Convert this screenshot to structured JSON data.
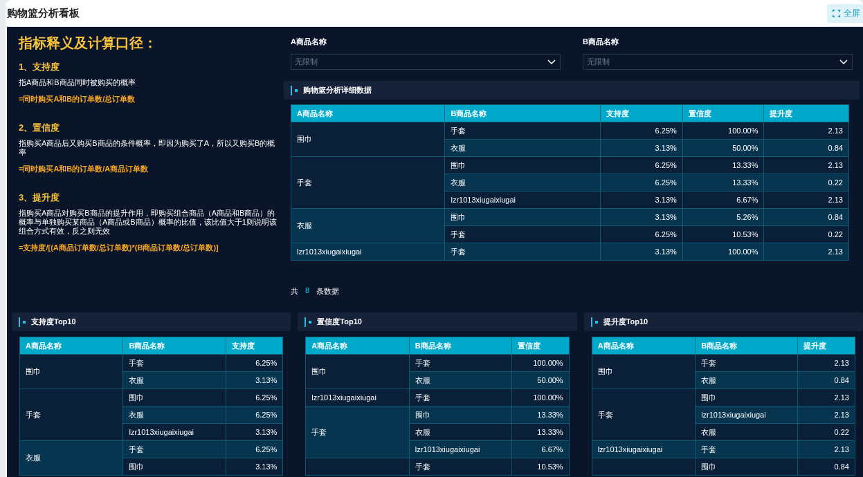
{
  "page": {
    "title": "购物篮分析看板",
    "fullscreen_button": {
      "label": "全屏"
    }
  },
  "definitions": {
    "heading": "指标释义及计算口径：",
    "items": [
      {
        "title": "1、支持度",
        "description": "指A商品和B商品同时被购买的概率",
        "formula": "=同时购买A和B的订单数/总订单数"
      },
      {
        "title": "2、置信度",
        "description": "指购买A商品后又购买B商品的条件概率，即因为购买了A，所以又购买B的概率",
        "formula": "=同时购买A和B的订单数/A商品订单数"
      },
      {
        "title": "3、提升度",
        "description": "指购买A商品对购买B商品的提升作用，即购买组合商品（A商品和B商品）的概率与单独购买某商品（A商品或B商品）概率的比值，该比值大于1则说明该组合方式有效，反之则无效",
        "formula": "=支持度/[(A商品订单数/总订单数)*(B商品订单数/总订单数)]"
      }
    ]
  },
  "filters": [
    {
      "label": "A商品名称",
      "placeholder": "无限制"
    },
    {
      "label": "B商品名称",
      "placeholder": "无限制"
    }
  ],
  "detail": {
    "title": "购物篮分析详细数据",
    "columns": [
      "A商品名称",
      "B商品名称",
      "支持度",
      "置信度",
      "提升度"
    ],
    "groups": [
      {
        "a": "围巾",
        "rows": [
          [
            "手套",
            "6.25%",
            "100.00%",
            "2.13"
          ],
          [
            "衣服",
            "3.13%",
            "50.00%",
            "0.84"
          ]
        ]
      },
      {
        "a": "手套",
        "rows": [
          [
            "围巾",
            "6.25%",
            "13.33%",
            "2.13"
          ],
          [
            "衣服",
            "6.25%",
            "13.33%",
            "0.22"
          ],
          [
            "lzr1013xiugaixiugai",
            "3.13%",
            "6.67%",
            "2.13"
          ]
        ]
      },
      {
        "a": "衣服",
        "rows": [
          [
            "围巾",
            "3.13%",
            "5.26%",
            "0.84"
          ],
          [
            "手套",
            "6.25%",
            "10.53%",
            "0.22"
          ]
        ]
      },
      {
        "a": "lzr1013xiugaixiugai",
        "rows": [
          [
            "手套",
            "3.13%",
            "100.00%",
            "2.13"
          ]
        ]
      }
    ],
    "footer": {
      "prefix": "共",
      "count": "8",
      "suffix": "条数据"
    }
  },
  "top10": [
    {
      "title": "支持度Top10",
      "columns": [
        "A商品名称",
        "B商品名称",
        "支持度"
      ],
      "groups": [
        {
          "a": "围巾",
          "rows": [
            [
              "手套",
              "6.25%"
            ],
            [
              "衣服",
              "3.13%"
            ]
          ]
        },
        {
          "a": "手套",
          "rows": [
            [
              "围巾",
              "6.25%"
            ],
            [
              "衣服",
              "6.25%"
            ],
            [
              "lzr1013xiugaixiugai",
              "3.13%"
            ]
          ]
        },
        {
          "a": "衣服",
          "rows": [
            [
              "手套",
              "6.25%"
            ],
            [
              "围巾",
              "3.13%"
            ]
          ]
        }
      ]
    },
    {
      "title": "置信度Top10",
      "columns": [
        "A商品名称",
        "B商品名称",
        "置信度"
      ],
      "groups": [
        {
          "a": "围巾",
          "rows": [
            [
              "手套",
              "100.00%"
            ],
            [
              "衣服",
              "50.00%"
            ]
          ]
        },
        {
          "a": "lzr1013xiugaixiugai",
          "rows": [
            [
              "手套",
              "100.00%"
            ]
          ]
        },
        {
          "a": "手套",
          "rows": [
            [
              "围巾",
              "13.33%"
            ],
            [
              "衣服",
              "13.33%"
            ],
            [
              "lzr1013xiugaixiugai",
              "6.67%"
            ]
          ]
        },
        {
          "rows": [
            [
              "手套",
              "10.53%"
            ]
          ]
        }
      ]
    },
    {
      "title": "提升度Top10",
      "columns": [
        "A商品名称",
        "B商品名称",
        "提升度"
      ],
      "groups": [
        {
          "a": "围巾",
          "rows": [
            [
              "手套",
              "2.13"
            ],
            [
              "衣服",
              "0.84"
            ]
          ]
        },
        {
          "a": "手套",
          "rows": [
            [
              "围巾",
              "2.13"
            ],
            [
              "lzr1013xiugaixiugai",
              "2.13"
            ],
            [
              "衣服",
              "0.22"
            ]
          ]
        },
        {
          "a": "lzr1013xiugaixiugai",
          "rows": [
            [
              "手套",
              "2.13"
            ]
          ]
        },
        {
          "rows": [
            [
              "围巾",
              "0.84"
            ]
          ]
        }
      ]
    }
  ]
}
